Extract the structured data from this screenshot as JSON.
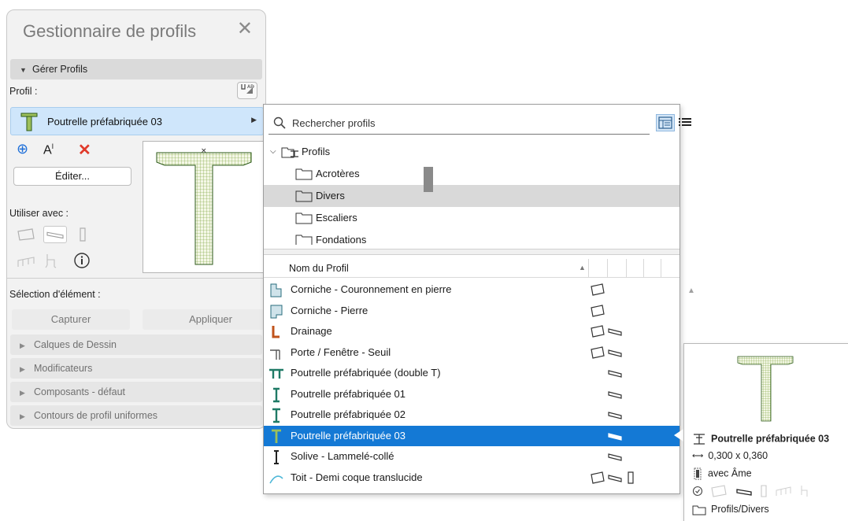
{
  "panel": {
    "title": "Gestionnaire de profils",
    "manage_section": "Gérer Profils",
    "profile_label": "Profil :",
    "selected_profile": "Poutrelle préfabriquée 03",
    "edit_button": "Éditer...",
    "use_with_label": "Utiliser avec :",
    "element_selection_label": "Sélection d'élément :",
    "capture_button": "Capturer",
    "apply_button": "Appliquer",
    "collapsed_sections": [
      "Calques de Dessin",
      "Modificateurs",
      "Composants - défaut",
      "Contours de profil uniformes"
    ]
  },
  "browser": {
    "search_placeholder": "Rechercher profils",
    "tree_root": "Profils",
    "folders": [
      "Acrotères",
      "Divers",
      "Escaliers",
      "Fondations"
    ],
    "selected_folder": "Divers",
    "column_header": "Nom du Profil",
    "profiles": [
      {
        "name": "Corniche - Couronnement en pierre",
        "uses": [
          "wall"
        ]
      },
      {
        "name": "Corniche - Pierre",
        "uses": [
          "wall"
        ]
      },
      {
        "name": "Drainage",
        "uses": [
          "wall",
          "beam"
        ]
      },
      {
        "name": "Porte / Fenêtre - Seuil",
        "uses": [
          "wall",
          "beam"
        ]
      },
      {
        "name": "Poutrelle préfabriquée (double T)",
        "uses": [
          "beam"
        ]
      },
      {
        "name": "Poutrelle préfabriquée 01",
        "uses": [
          "beam"
        ]
      },
      {
        "name": "Poutrelle préfabriquée 02",
        "uses": [
          "beam"
        ]
      },
      {
        "name": "Poutrelle préfabriquée 03",
        "uses": [
          "beam"
        ]
      },
      {
        "name": "Solive - Lammelé-collé",
        "uses": [
          "beam"
        ]
      },
      {
        "name": "Toit - Demi coque translucide",
        "uses": [
          "wall",
          "beam",
          "column"
        ]
      }
    ],
    "selected_profile_index": 7
  },
  "tooltip": {
    "name": "Poutrelle préfabriquée 03",
    "dimensions": "0,300 x 0,360",
    "core": "avec Âme",
    "path": "Profils/Divers"
  },
  "colors": {
    "selection_blue": "#1479d5",
    "selected_profile_bg": "#cfe6fb",
    "profile_hatch": "#6f9a2a",
    "delete_red": "#e03a2a",
    "add_blue": "#1e6fd9"
  }
}
